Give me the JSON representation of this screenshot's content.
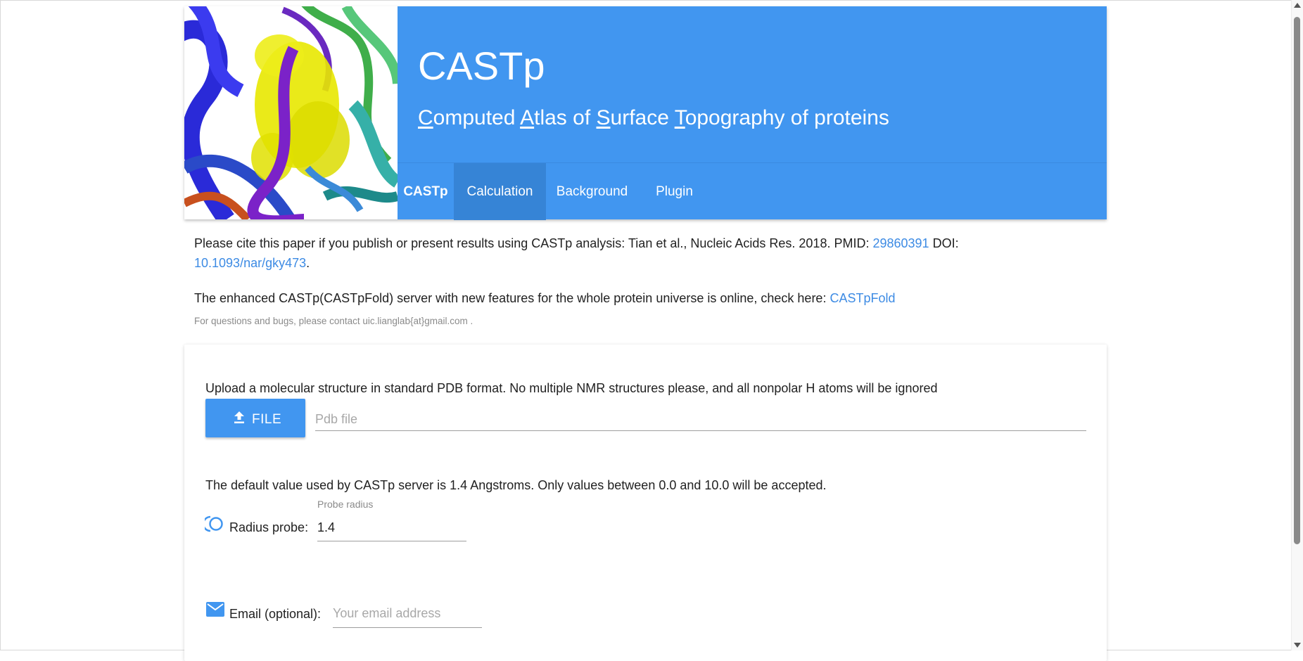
{
  "header": {
    "title": "CASTp",
    "subtitle_parts": [
      {
        "initial": "C",
        "rest": "omputed "
      },
      {
        "initial": "A",
        "rest": "tlas of "
      },
      {
        "initial": "S",
        "rest": "urface "
      },
      {
        "initial": "T",
        "rest": "opography of proteins"
      }
    ],
    "image_icon": "protein-structure-image"
  },
  "nav": {
    "items": [
      {
        "label": "CASTp"
      },
      {
        "label": "Calculation"
      },
      {
        "label": "Background"
      },
      {
        "label": "Plugin"
      }
    ],
    "active": "Calculation"
  },
  "notice": {
    "cite_text": "Please cite this paper if you publish or present results using CASTp analysis: Tian et al., Nucleic Acids Res. 2018. PMID: ",
    "pmid_link": "29860391",
    "doi_label": " DOI: ",
    "doi_link": "10.1093/nar/gky473",
    "doi_end": ".",
    "enhanced_text": "The enhanced CASTp(CASTpFold) server with new features for the whole protein universe is online, check here: ",
    "enhanced_link": "CASTpFold",
    "contact": "For questions and bugs, please contact uic.lianglab{at}gmail.com ."
  },
  "form": {
    "upload_instructions": "Upload a molecular structure in standard PDB format. No multiple NMR structures please, and all nonpolar H atoms will be ignored",
    "file_button": "FILE",
    "pdb_placeholder": "Pdb file",
    "radius_note": "The default value used by CASTp server is 1.4 Angstroms. Only values between 0.0 and 10.0 will be accepted.",
    "radius_label": "Radius probe:",
    "probe_caption": "Probe radius",
    "probe_value": "1.4",
    "email_label": "Email (optional):",
    "email_placeholder": "Your email address"
  },
  "colors": {
    "brand_blue": "#4196f0",
    "nav_active": "#3684d6",
    "link": "#3d8be4"
  }
}
